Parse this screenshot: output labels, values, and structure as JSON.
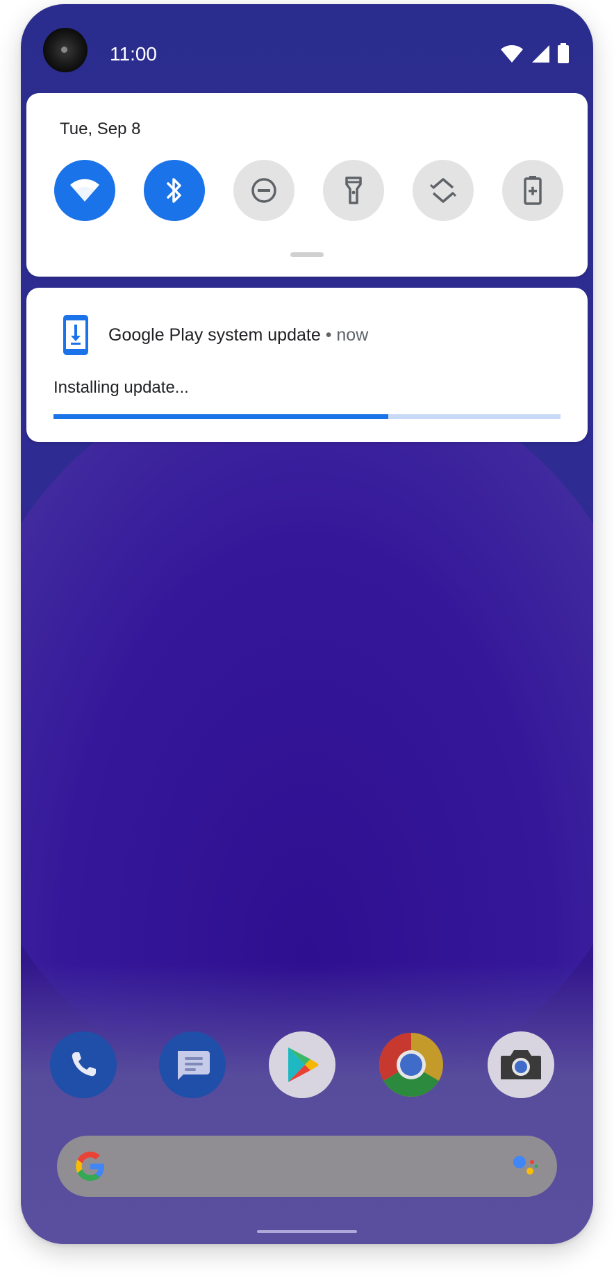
{
  "status_bar": {
    "time": "11:00",
    "icons": [
      "camera-cutout",
      "wifi-icon",
      "cell-signal-icon",
      "battery-icon"
    ]
  },
  "quick_settings": {
    "date": "Tue, Sep 8",
    "tiles": [
      {
        "name": "wifi",
        "icon": "wifi-icon",
        "active": true
      },
      {
        "name": "bluetooth",
        "icon": "bluetooth-icon",
        "active": true
      },
      {
        "name": "do-not-disturb",
        "icon": "do-not-disturb-icon",
        "active": false
      },
      {
        "name": "flashlight",
        "icon": "flashlight-icon",
        "active": false
      },
      {
        "name": "auto-rotate",
        "icon": "auto-rotate-icon",
        "active": false
      },
      {
        "name": "battery-saver",
        "icon": "battery-saver-icon",
        "active": false
      }
    ]
  },
  "notification": {
    "app_icon": "system-update-icon",
    "title": "Google Play system update",
    "separator": "•",
    "time": "now",
    "body": "Installing update...",
    "progress": 0.66
  },
  "dock": {
    "apps": [
      "phone-icon",
      "messages-icon",
      "play-store-icon",
      "chrome-icon",
      "camera-icon"
    ]
  },
  "search_bar": {
    "left_icon": "google-g-icon",
    "right_icon": "assistant-icon"
  },
  "colors": {
    "accent": "#1a73e8",
    "tile_off": "#e3e3e3",
    "progress_track": "#c9daf8"
  }
}
